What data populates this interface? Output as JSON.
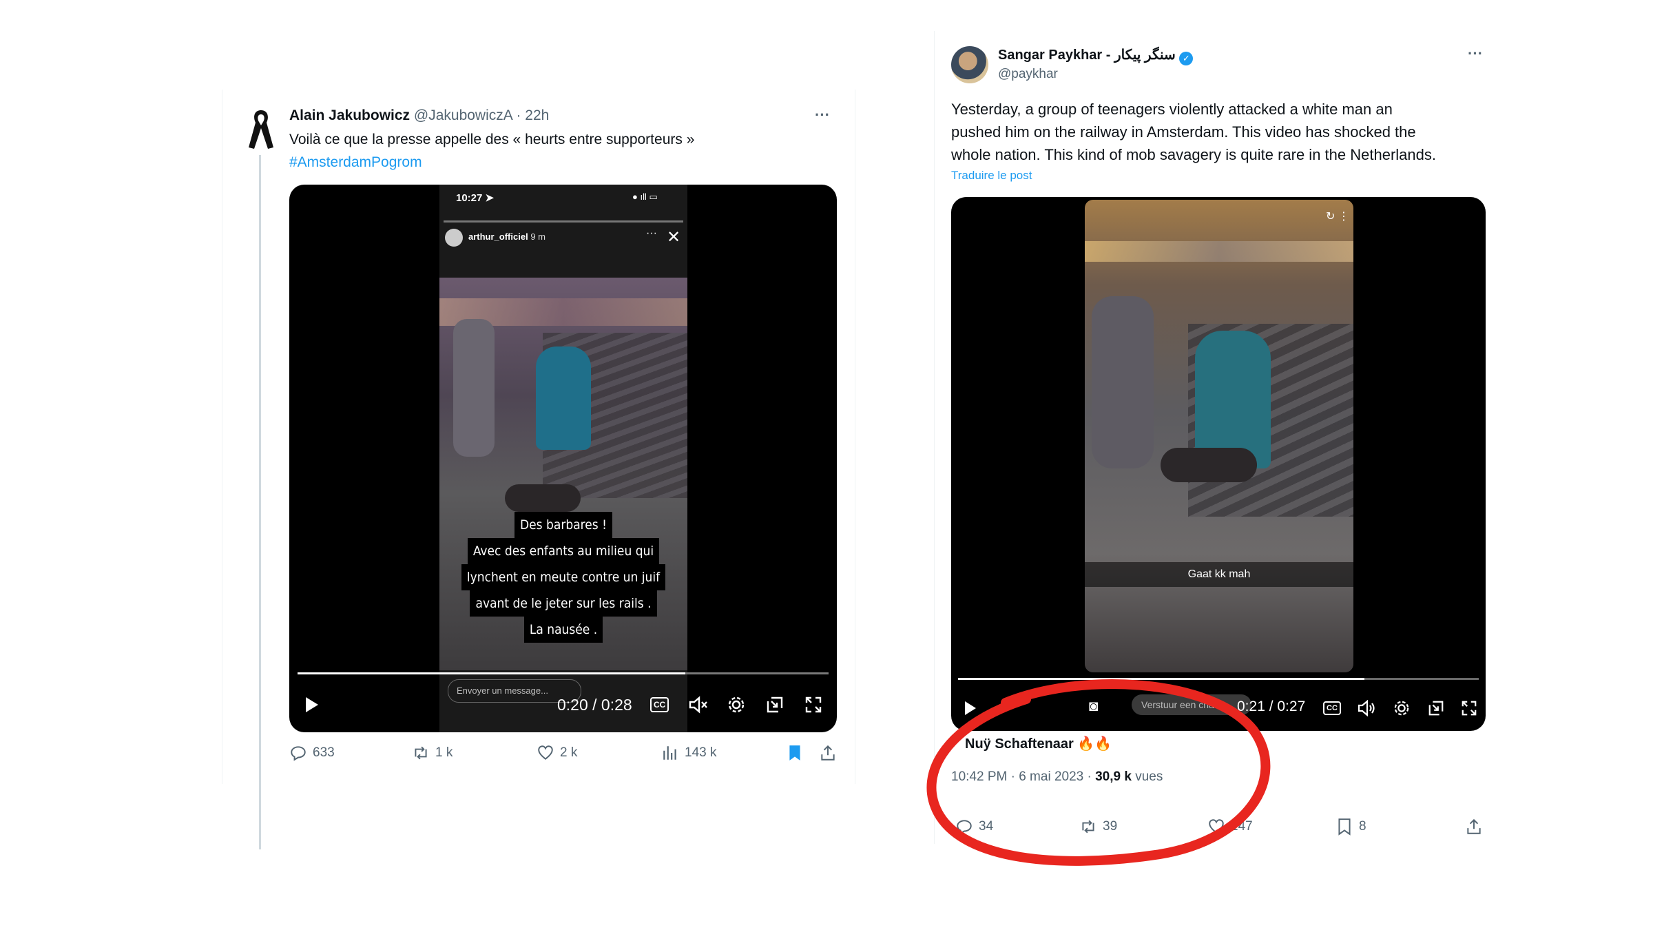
{
  "tweet1": {
    "author_name": "Alain Jakubowicz",
    "handle_time": "@JakubowiczA · 22h",
    "more": "···",
    "text_line1": "Voilà ce que la presse appelle des « heurts entre supporteurs »",
    "hashtag": "#AmsterdamPogrom",
    "video": {
      "phone_time": "10:27",
      "story_user": "arthur_officiel",
      "story_age": "9 m",
      "caption_lines": [
        "Des barbares !",
        "Avec des enfants au milieu qui",
        "lynchent  en meute contre un juif",
        "avant de le jeter sur les rails .",
        "La nausée ."
      ],
      "message_placeholder": "Envoyer un message...",
      "time": "0:20 / 0:28",
      "progress": 0.73,
      "cc": "CC"
    },
    "actions": {
      "replies": "633",
      "reposts": "1 k",
      "likes": "2 k",
      "views": "143 k"
    }
  },
  "tweet2": {
    "author_name": "Sangar Paykhar - سنگر پیکار",
    "handle": "@paykhar",
    "more": "···",
    "text_lines": [
      "Yesterday, a group of teenagers violently attacked a white man an",
      "pushed him on the railway in Amsterdam. This video has shocked the",
      "whole nation. This kind of mob savagery is quite rare in the Netherlands."
    ],
    "translate": "Traduire le post",
    "video": {
      "caption": "Gaat kk mah",
      "reply_placeholder": "Verstuur een chat",
      "time": "0:21 / 0:27",
      "progress": 0.78,
      "cc": "CC"
    },
    "overlay_name": "Nuÿ Schaftenaar 🔥🔥",
    "meta_time": "10:42 PM · 6 mai 2023 · ",
    "meta_views": "30,9 k",
    "meta_views_label": " vues",
    "actions": {
      "replies": "34",
      "reposts": "39",
      "likes": "147",
      "bookmarks": "8"
    }
  },
  "colors": {
    "accent": "#1d9bf0",
    "circle": "#e8261f",
    "muted": "#536471"
  }
}
